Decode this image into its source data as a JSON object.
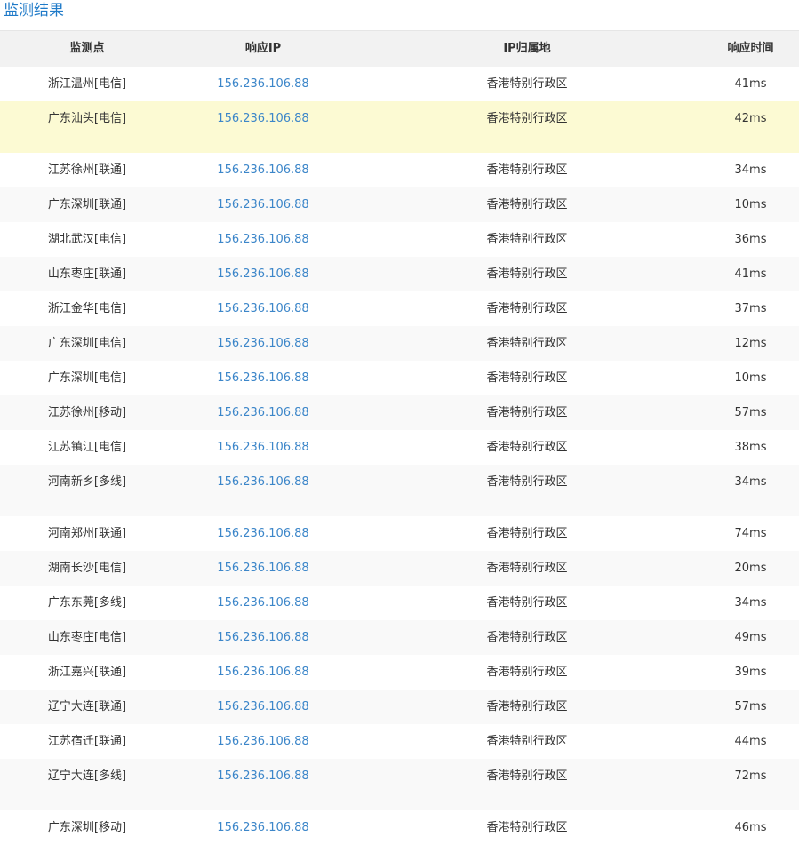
{
  "header": {
    "title": "监测结果"
  },
  "table": {
    "columns": [
      "监测点",
      "响应IP",
      "IP归属地",
      "响应时间"
    ],
    "rows": [
      {
        "point": "浙江温州[电信]",
        "ip": "156.236.106.88",
        "loc": "香港特别行政区",
        "time": "41ms"
      },
      {
        "point": "广东汕头[电信]",
        "ip": "156.236.106.88",
        "loc": "香港特别行政区",
        "time": "42ms"
      },
      {
        "point": "江苏徐州[联通]",
        "ip": "156.236.106.88",
        "loc": "香港特别行政区",
        "time": "34ms"
      },
      {
        "point": "广东深圳[联通]",
        "ip": "156.236.106.88",
        "loc": "香港特别行政区",
        "time": "10ms"
      },
      {
        "point": "湖北武汉[电信]",
        "ip": "156.236.106.88",
        "loc": "香港特别行政区",
        "time": "36ms"
      },
      {
        "point": "山东枣庄[联通]",
        "ip": "156.236.106.88",
        "loc": "香港特别行政区",
        "time": "41ms"
      },
      {
        "point": "浙江金华[电信]",
        "ip": "156.236.106.88",
        "loc": "香港特别行政区",
        "time": "37ms"
      },
      {
        "point": "广东深圳[电信]",
        "ip": "156.236.106.88",
        "loc": "香港特别行政区",
        "time": "12ms"
      },
      {
        "point": "广东深圳[电信]",
        "ip": "156.236.106.88",
        "loc": "香港特别行政区",
        "time": "10ms"
      },
      {
        "point": "江苏徐州[移动]",
        "ip": "156.236.106.88",
        "loc": "香港特别行政区",
        "time": "57ms"
      },
      {
        "point": "江苏镇江[电信]",
        "ip": "156.236.106.88",
        "loc": "香港特别行政区",
        "time": "38ms"
      },
      {
        "point": "河南新乡[多线]",
        "ip": "156.236.106.88",
        "loc": "香港特别行政区",
        "time": "34ms"
      },
      {
        "point": "河南郑州[联通]",
        "ip": "156.236.106.88",
        "loc": "香港特别行政区",
        "time": "74ms"
      },
      {
        "point": "湖南长沙[电信]",
        "ip": "156.236.106.88",
        "loc": "香港特别行政区",
        "time": "20ms"
      },
      {
        "point": "广东东莞[多线]",
        "ip": "156.236.106.88",
        "loc": "香港特别行政区",
        "time": "34ms"
      },
      {
        "point": "山东枣庄[电信]",
        "ip": "156.236.106.88",
        "loc": "香港特别行政区",
        "time": "49ms"
      },
      {
        "point": "浙江嘉兴[联通]",
        "ip": "156.236.106.88",
        "loc": "香港特别行政区",
        "time": "39ms"
      },
      {
        "point": "辽宁大连[联通]",
        "ip": "156.236.106.88",
        "loc": "香港特别行政区",
        "time": "57ms"
      },
      {
        "point": "江苏宿迁[联通]",
        "ip": "156.236.106.88",
        "loc": "香港特别行政区",
        "time": "44ms"
      },
      {
        "point": "辽宁大连[多线]",
        "ip": "156.236.106.88",
        "loc": "香港特别行政区",
        "time": "72ms"
      },
      {
        "point": "广东深圳[移动]",
        "ip": "156.236.106.88",
        "loc": "香港特别行政区",
        "time": "46ms"
      }
    ]
  },
  "colors": {
    "title": "#1f7ac8",
    "ip_link": "#3c86c9",
    "highlight_row": "#fcfad3",
    "header_bg": "#f2f2f2"
  }
}
